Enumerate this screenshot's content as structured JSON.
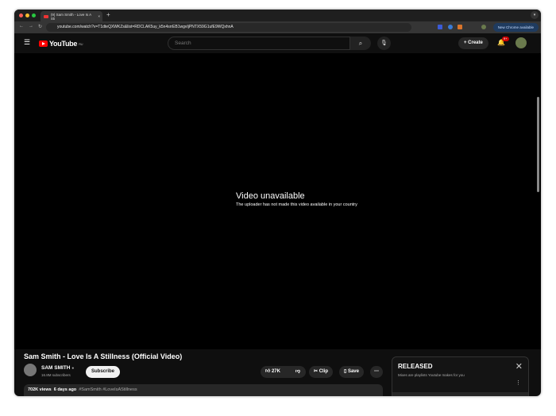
{
  "browser": {
    "tab_title": "(9) Sam Smith - Love Is A Sti",
    "url": "youtube.com/watch?v=T1dteQXWKZs&list=RDCLAK5uy_k5n4srrEB1wgvIjPNTX59G1ufE9WQxhnA",
    "update_label": "New Chrome available"
  },
  "header": {
    "logo": "YouTube",
    "region": "RU",
    "search_placeholder": "Search",
    "create_label": "Create",
    "notif_count": "9+"
  },
  "player": {
    "error_title": "Video unavailable",
    "error_message": "The uploader has not made this video available in your country"
  },
  "video": {
    "title": "Sam Smith - Love Is A Stillness (Official Video)",
    "channel": "SAM SMITH",
    "subscribers": "16.8M subscribers",
    "subscribe_label": "Subscribe",
    "likes": "27K",
    "clip_label": "Clip",
    "save_label": "Save",
    "views": "702K views",
    "date": "6 days ago",
    "tags": "#SamSmith #LoveIsAStillness"
  },
  "panel": {
    "title": "RELEASED",
    "subtitle": "Mixes are playlists Youtube makes for you"
  }
}
